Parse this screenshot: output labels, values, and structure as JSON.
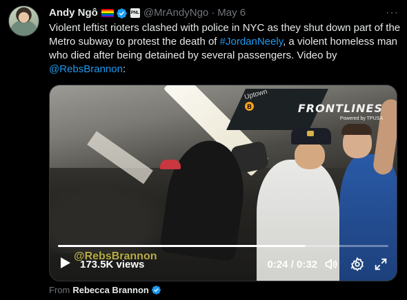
{
  "author": {
    "name": "Andy Ngô",
    "handle": "@MrAndyNgo",
    "separator": "·",
    "date": "May 6",
    "affiliate_label": "PNL"
  },
  "menu": {
    "more_glyph": "···"
  },
  "tweet": {
    "text_part1": "Violent leftist rioters clashed with police in NYC as they shut down part of the Metro subway to protest the death of ",
    "hashtag": "#JordanNeely",
    "text_part2": ", a violent homeless man who died after being detained by several passengers. Video by ",
    "mention": "@RebsBrannon",
    "text_part3": ":"
  },
  "video": {
    "brand": "FRONTLINES",
    "brand_sub": "Powered by TPUSA",
    "watermark": "@RebsBrannon",
    "subway_sign": "Uptown",
    "subway_line": "B",
    "views": "173.5K views",
    "time": "0:24 / 0:32",
    "progress": 0.75
  },
  "footer": {
    "from_label": "From",
    "from_name": "Rebecca Brannon"
  },
  "colors": {
    "link": "#1d9bf0",
    "muted": "#71767b",
    "background": "#000000"
  }
}
